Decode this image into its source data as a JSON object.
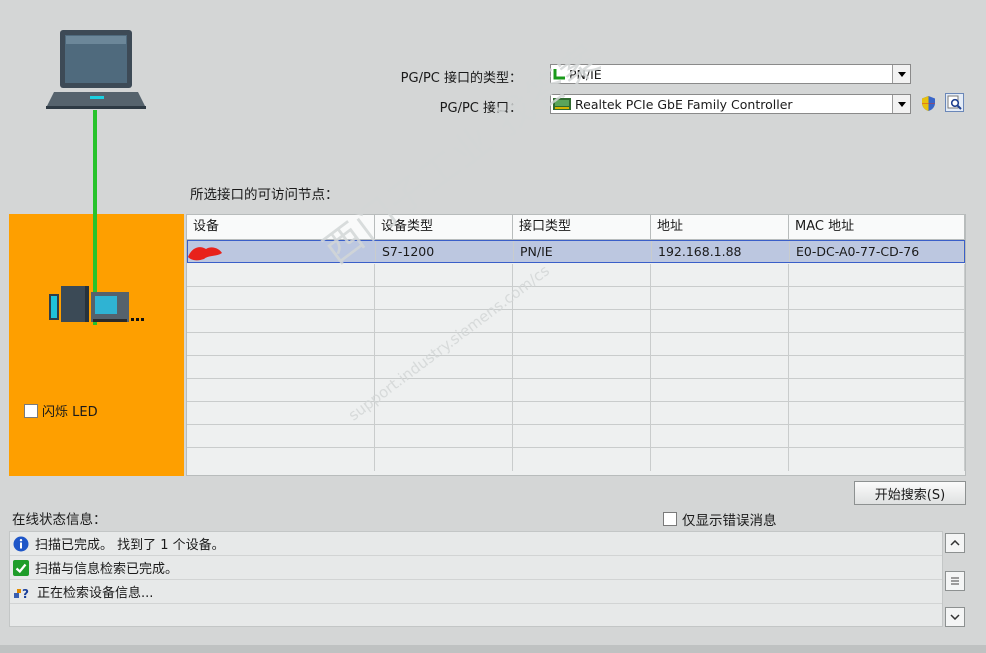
{
  "interface": {
    "type_label": "PG/PC 接口的类型：",
    "type_value": "PN/IE",
    "iface_label": "PG/PC 接口：",
    "iface_value": "Realtek PCIe GbE Family Controller"
  },
  "nodes_label": "所选接口的可访问节点：",
  "flash_led_label": "闪烁 LED",
  "table": {
    "headers": [
      "设备",
      "设备类型",
      "接口类型",
      "地址",
      "MAC 地址"
    ],
    "rows": [
      {
        "device": "",
        "device_type": "S7-1200",
        "iface_type": "PN/IE",
        "address": "192.168.1.88",
        "mac": "E0-DC-A0-77-CD-76"
      }
    ]
  },
  "start_search_button": "开始搜索(S)",
  "online_status_label": "在线状态信息：",
  "show_errors_only_label": "仅显示错误消息",
  "status_messages": [
    {
      "icon": "info-icon",
      "text": "扫描已完成。 找到了 1 个设备。"
    },
    {
      "icon": "check-icon",
      "text": "扫描与信息检索已完成。"
    },
    {
      "icon": "network-query-icon",
      "text": "正在检索设备信息..."
    }
  ],
  "watermark": {
    "line1": "西门子工业  找答案",
    "line2": "support.industry.siemens.com/cs"
  },
  "colors": {
    "orange": "#fe9f00",
    "link_green": "#27c32b",
    "selection": "#bcc7e0"
  }
}
